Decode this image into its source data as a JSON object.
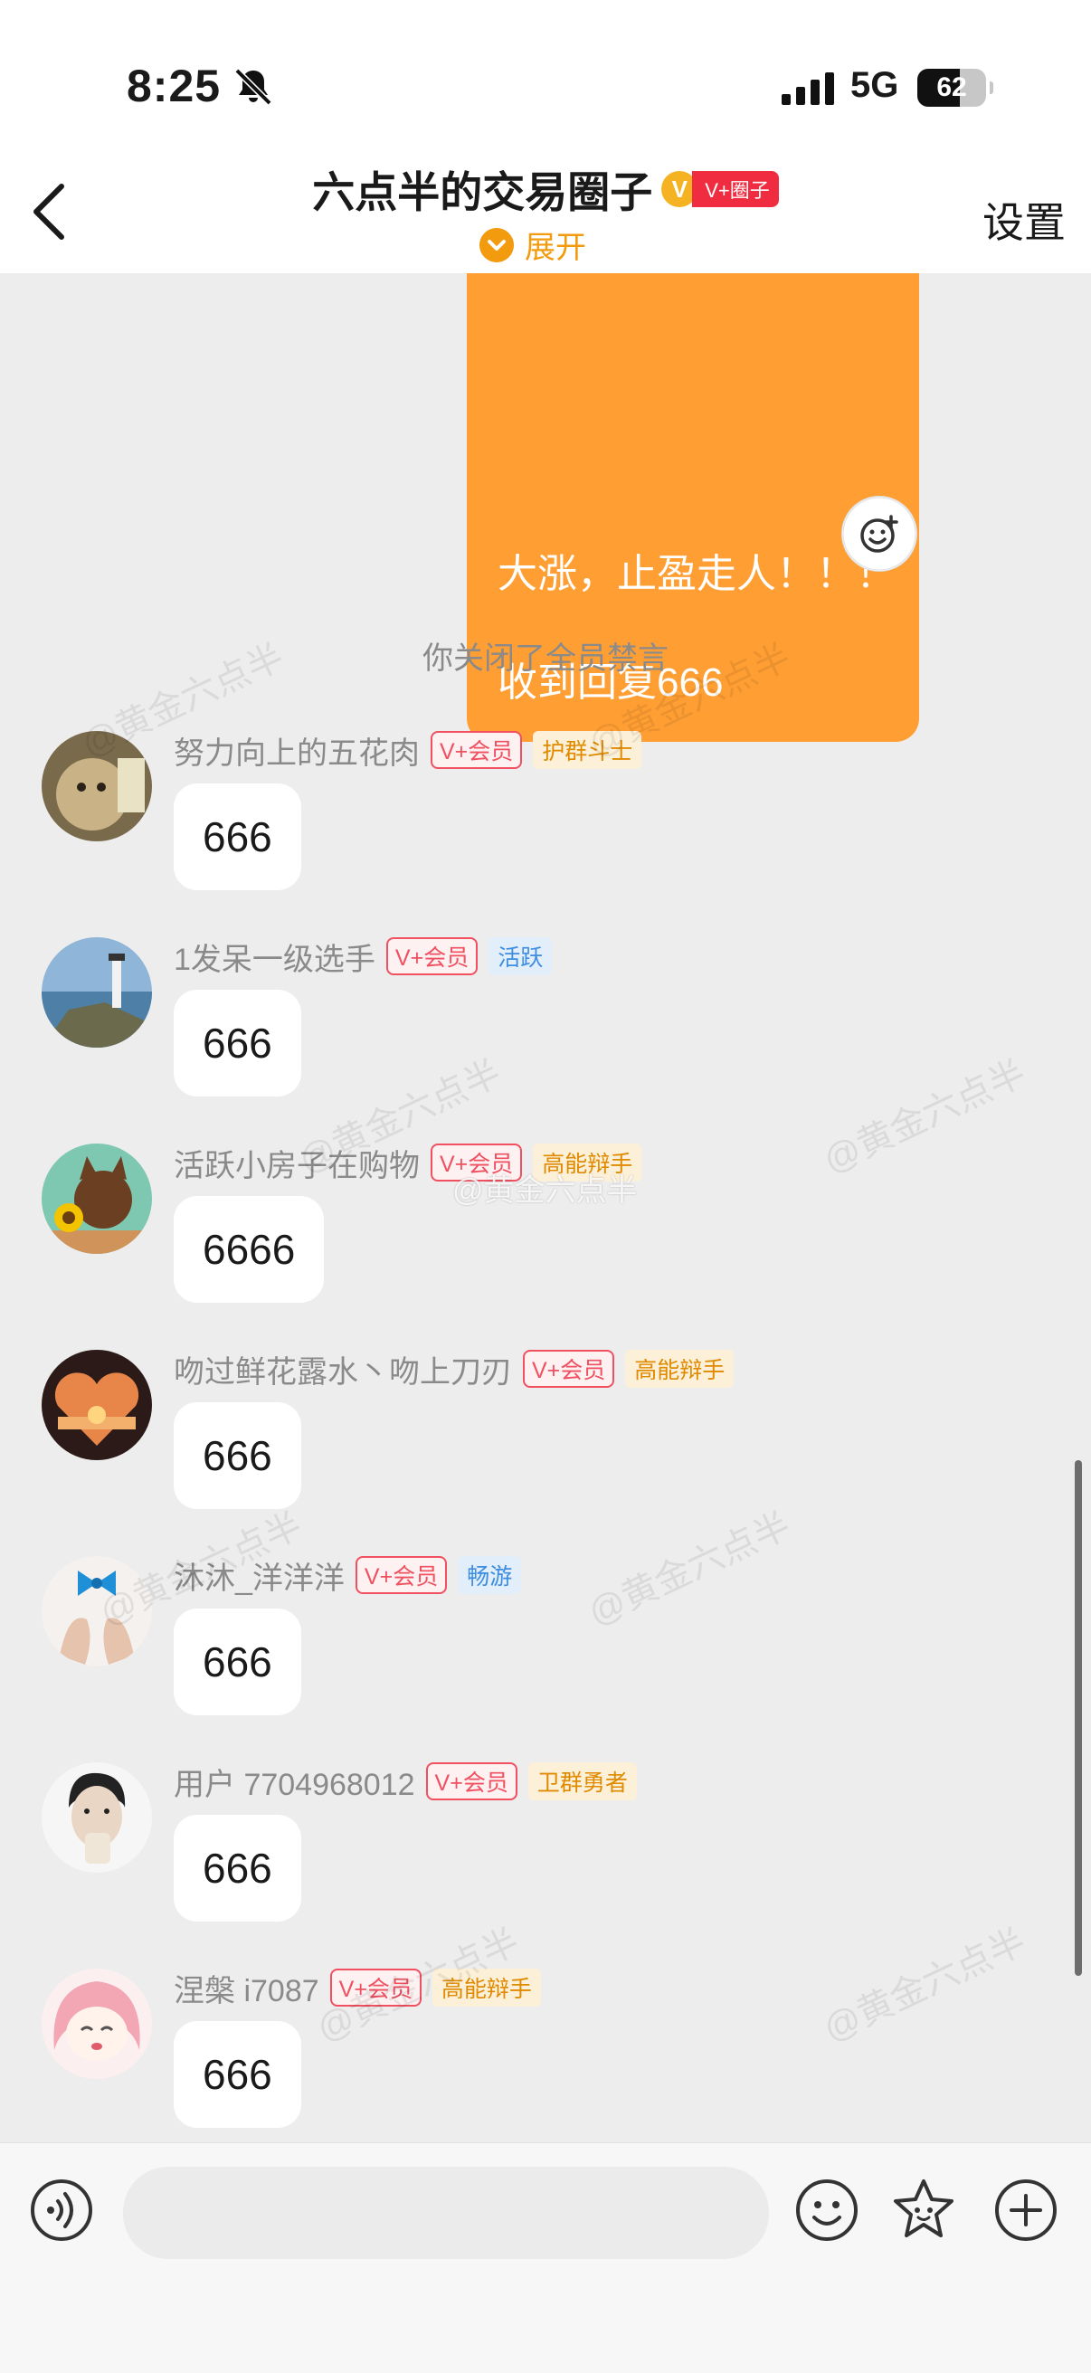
{
  "status_bar": {
    "time": "8:25",
    "network": "5G",
    "battery": "62",
    "battery_level": 0.62
  },
  "header": {
    "title": "六点半的交易圈子",
    "badge_letter": "V",
    "badge_label": "V+圈子",
    "expand_label": "展开",
    "settings_label": "设置"
  },
  "self_message": {
    "line1": "大涨，止盈走人！！！",
    "line2": "收到回复666"
  },
  "system_message": "你关闭了全员禁言",
  "messages": [
    {
      "name": "努力向上的五花肉",
      "vip": "V+会员",
      "role": "护群斗士",
      "role_color": "orange",
      "text": "666"
    },
    {
      "name": "1发呆一级选手",
      "vip": "V+会员",
      "role": "活跃",
      "role_color": "blue",
      "text": "666"
    },
    {
      "name": "活跃小房子在购物",
      "vip": "V+会员",
      "role": "高能辩手",
      "role_color": "orange",
      "text": "6666"
    },
    {
      "name": "吻过鲜花露水丶吻上刀刃",
      "vip": "V+会员",
      "role": "高能辩手",
      "role_color": "orange",
      "text": "666"
    },
    {
      "name": "沐沐_洋洋洋",
      "vip": "V+会员",
      "role": "畅游",
      "role_color": "blue",
      "text": "666"
    },
    {
      "name": "用户 7704968012",
      "vip": "V+会员",
      "role": "卫群勇者",
      "role_color": "orange",
      "text": "666"
    },
    {
      "name": "涅槃 i7087",
      "vip": "V+会员",
      "role": "高能辩手",
      "role_color": "orange",
      "text": "666"
    }
  ],
  "watermark": "@黄金六点半",
  "center_watermark": "@黄金六点半",
  "colors": {
    "accent": "#ff9f33",
    "vip_red": "#f05060",
    "role_orange": "#e08a00",
    "role_blue": "#3d8ee0"
  },
  "icons": [
    "bell-slash-icon",
    "signal-icon",
    "battery-icon",
    "back-icon",
    "chevron-down-icon",
    "emoji-reaction-icon",
    "voice-icon",
    "smile-icon",
    "star-icon",
    "plus-icon"
  ]
}
